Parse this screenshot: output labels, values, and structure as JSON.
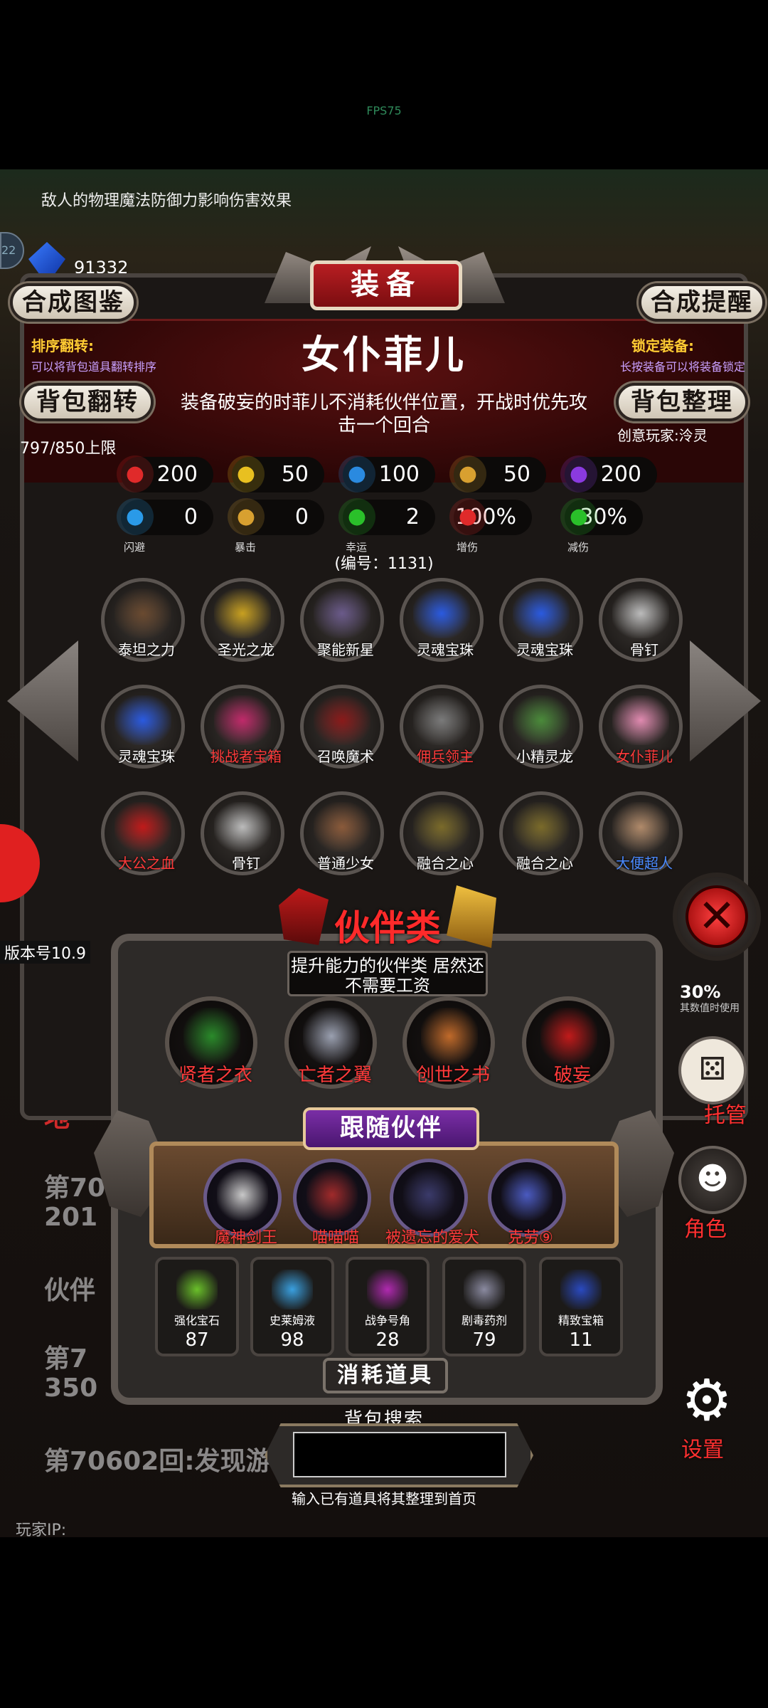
{
  "fps": "FPS75",
  "hint": "敌人的物理魔法防御力影响伤害效果",
  "currency": {
    "gold": "91332",
    "orb_level": "22"
  },
  "header": {
    "title": "装备",
    "synth_codex": "合成图鉴",
    "synth_remind": "合成提醒",
    "bag_flip": "背包翻转",
    "bag_sort": "背包整理"
  },
  "sort": {
    "label": "排序翻转:",
    "desc": "可以将背包道具翻转排序"
  },
  "lock": {
    "label": "锁定装备:",
    "desc": "长按装备可以将装备锁定"
  },
  "item": {
    "name": "女仆菲儿",
    "description": "装备破妄的时菲儿不消耗伙伴位置，开战时优先攻击一个回合",
    "creator": "创意玩家:泠灵",
    "capacity": "797/850上限",
    "serial": "(编号：1131)"
  },
  "stats": [
    {
      "icon": "heart-icon",
      "value": "200",
      "color": "#e02a2a",
      "label": ""
    },
    {
      "icon": "muscle-icon",
      "value": "50",
      "color": "#e8c020",
      "label": ""
    },
    {
      "icon": "armor-icon",
      "value": "100",
      "color": "#2a8ae0",
      "label": ""
    },
    {
      "icon": "sword-icon",
      "value": "50",
      "color": "#d8a030",
      "label": ""
    },
    {
      "icon": "magic-icon",
      "value": "200",
      "color": "#8a3ae0",
      "label": ""
    },
    {
      "icon": "dodge-icon",
      "value": "0",
      "color": "#2a9ae8",
      "label": "闪避"
    },
    {
      "icon": "crit-icon",
      "value": "0",
      "color": "#d8a030",
      "label": "暴击"
    },
    {
      "icon": "clover-icon",
      "value": "2",
      "color": "#2ac02a",
      "label": "幸运"
    },
    {
      "icon": "dmg-up-icon",
      "value": "100%",
      "color": "#e02a2a",
      "label": "增伤"
    },
    {
      "icon": "dmg-down-icon",
      "value": "30%",
      "color": "#2ac02a",
      "label": "减伤"
    }
  ],
  "inventory": [
    {
      "name": "泰坦之力",
      "color": "#ffffff",
      "art": "#6a4a30"
    },
    {
      "name": "圣光之龙",
      "color": "#ffffff",
      "art": "#c8a020"
    },
    {
      "name": "聚能新星",
      "color": "#ffffff",
      "art": "#6a5a8a"
    },
    {
      "name": "灵魂宝珠",
      "color": "#ffffff",
      "art": "#2a5ae0"
    },
    {
      "name": "灵魂宝珠",
      "color": "#ffffff",
      "art": "#2a5ae0"
    },
    {
      "name": "骨钉",
      "color": "#ffffff",
      "art": "#bbbbbb"
    },
    {
      "name": "灵魂宝珠",
      "color": "#ffffff",
      "art": "#2a5ae0"
    },
    {
      "name": "挑战者宝箱",
      "color": "#ff3a3a",
      "art": "#c02a6a"
    },
    {
      "name": "召唤魔术",
      "color": "#ffffff",
      "art": "#8a1a1a"
    },
    {
      "name": "佣兵领主",
      "color": "#ff3a3a",
      "art": "#7a7a7a"
    },
    {
      "name": "小精灵龙",
      "color": "#ffffff",
      "art": "#4a8a3a"
    },
    {
      "name": "女仆菲儿",
      "color": "#ff3a3a",
      "art": "#e08ab0"
    },
    {
      "name": "大公之血",
      "color": "#ff3a3a",
      "art": "#c01a1a"
    },
    {
      "name": "骨钉",
      "color": "#ffffff",
      "art": "#bbbbbb"
    },
    {
      "name": "普通少女",
      "color": "#ffffff",
      "art": "#8a5a3a"
    },
    {
      "name": "融合之心",
      "color": "#ffffff",
      "art": "#7a6a2a"
    },
    {
      "name": "融合之心",
      "color": "#ffffff",
      "art": "#7a6a2a"
    },
    {
      "name": "大便超人",
      "color": "#4a8aff",
      "art": "#b08a6a"
    }
  ],
  "version": "版本号10.9",
  "background_log": [
    "地",
    "第7060",
    "201",
    "伙伴",
    "第7",
    "350",
    "第70602回:发现游"
  ],
  "side_partial": {
    "percent": "30%",
    "note": "其数值时使用"
  },
  "partner_category": {
    "title": "伙伴类",
    "subtitle": "提升能力的伙伴类 居然还不需要工资",
    "items": [
      {
        "name": "贤者之衣",
        "art": "#2a8a2a"
      },
      {
        "name": "亡者之翼",
        "art": "#9aa0b0"
      },
      {
        "name": "创世之书",
        "art": "#c06a2a"
      },
      {
        "name": "破妄",
        "art": "#c01a1a"
      }
    ]
  },
  "follow": {
    "title": "跟随伙伴",
    "partners": [
      {
        "name": "魔神剑王",
        "art": "#c8c8c8"
      },
      {
        "name": "喵喵喵",
        "art": "#a02a2a"
      },
      {
        "name": "被遗忘的爱犬",
        "art": "#3a3a6a"
      },
      {
        "name": "克劳⑨",
        "art": "#4a5ac0"
      }
    ]
  },
  "consumables": {
    "title": "消耗道具",
    "items": [
      {
        "name": "强化宝石",
        "count": "87",
        "art": "#6ac02a"
      },
      {
        "name": "史莱姆液",
        "count": "98",
        "art": "#3aa0e0"
      },
      {
        "name": "战争号角",
        "count": "28",
        "art": "#b02ab0"
      },
      {
        "name": "剧毒药剂",
        "count": "79",
        "art": "#8a8aa0"
      },
      {
        "name": "精致宝箱",
        "count": "11",
        "art": "#2a4ac0"
      }
    ]
  },
  "search": {
    "label": "背包搜索",
    "value": "",
    "hint": "输入已有道具将其整理到首页"
  },
  "side_buttons": {
    "manage": "托管",
    "role": "角色",
    "settings": "设置"
  },
  "player_ip": "玩家IP:"
}
